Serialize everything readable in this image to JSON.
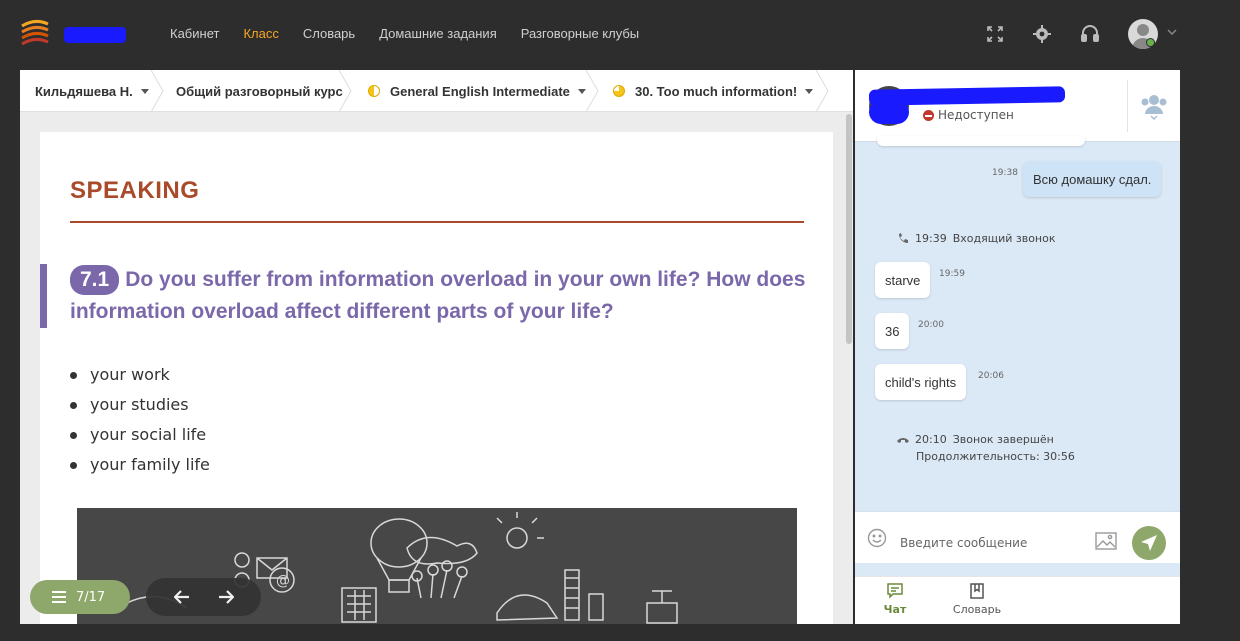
{
  "nav": {
    "items": [
      {
        "label": "Кабинет",
        "active": false
      },
      {
        "label": "Класс",
        "active": true
      },
      {
        "label": "Словарь",
        "active": false
      },
      {
        "label": "Домашние задания",
        "active": false
      },
      {
        "label": "Разговорные клубы",
        "active": false
      }
    ],
    "icons": [
      "fullscreen-icon",
      "gear-icon",
      "headset-icon"
    ],
    "accent": "#f5a623"
  },
  "breadcrumb": {
    "student": "Кильдяшева Н.",
    "course": "Общий разговорный курс",
    "level": "General English Intermediate",
    "lesson": "30. Too much information!"
  },
  "lesson": {
    "section_title": "SPEAKING",
    "question_number": "7.1",
    "question_text": "Do you suffer from information overload in your own life? How does information overload affect different parts of your life?",
    "bullets": [
      "your work",
      "your studies",
      "your social life",
      "your family life"
    ],
    "section_color": "#a94a2a",
    "question_color": "#7a68aa"
  },
  "pager": {
    "text": "7/17"
  },
  "chat": {
    "contact_status": "Недоступен",
    "messages": [
      {
        "text": "Всю домашку сдал.",
        "time": "19:38",
        "direction": "out"
      },
      {
        "text": "starve",
        "time": "19:59",
        "direction": "in"
      },
      {
        "text": "36",
        "time": "20:00",
        "direction": "in"
      },
      {
        "text": "child's rights",
        "time": "20:06",
        "direction": "in"
      }
    ],
    "incoming_call": {
      "time": "19:39",
      "label": "Входящий звонок"
    },
    "call_ended": {
      "time": "20:10",
      "label": "Звонок завершён",
      "duration_label": "Продолжительность:",
      "duration": "30:56"
    },
    "input_placeholder": "Введите сообщение",
    "tabs": [
      {
        "label": "Чат",
        "active": true
      },
      {
        "label": "Словарь",
        "active": false
      }
    ],
    "send_color": "#8ea76a"
  }
}
